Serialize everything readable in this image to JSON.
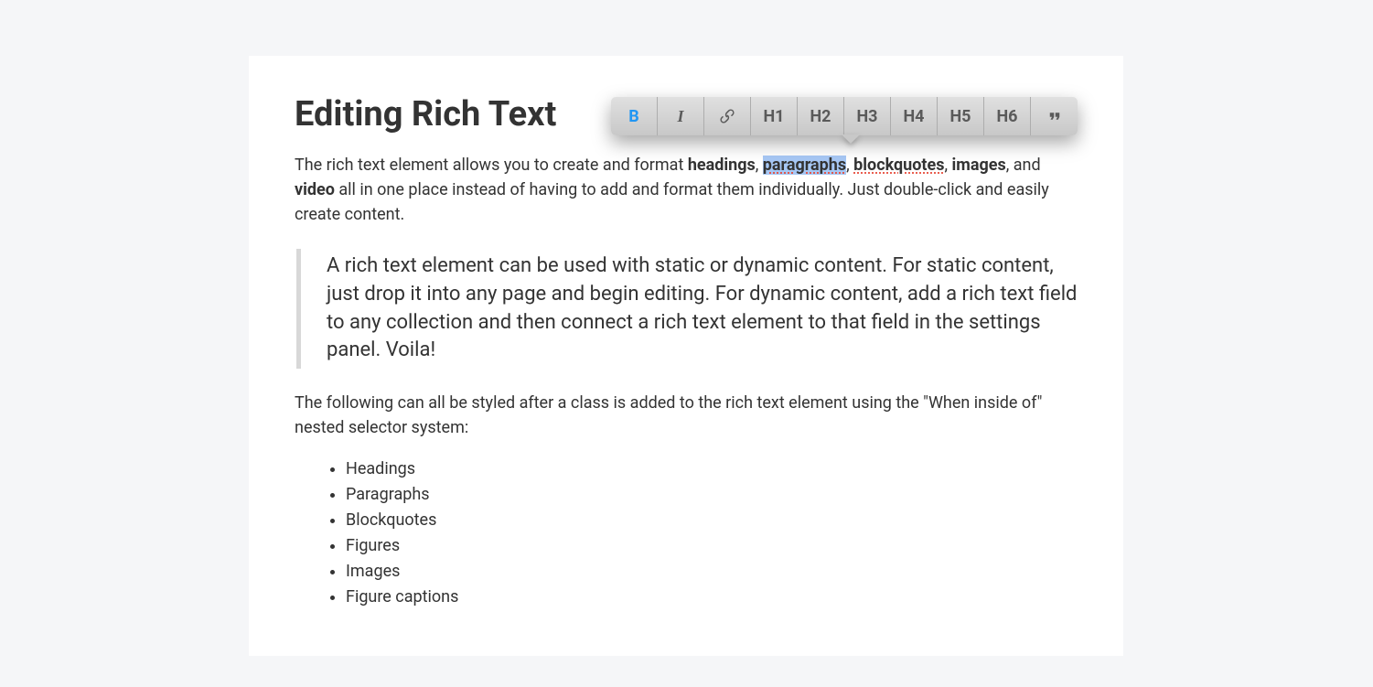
{
  "heading": "Editing Rich Text",
  "paragraph1": {
    "pre": "The rich text element allows you to create and format ",
    "headings": "headings",
    "sep1": ", ",
    "paragraphs": "paragraphs",
    "sep2": ", ",
    "blockquotes": "blockquotes",
    "sep3": ", ",
    "images": "images",
    "sep4": ", and ",
    "video": "video",
    "post": " all in one place instead of having to add and format them individually. Just double-click and easily create content."
  },
  "blockquote": "A rich text element can be used with static or dynamic content. For static content, just drop it into any page and begin editing. For dynamic content, add a rich text field to any collection and then connect a rich text element to that field in the settings panel. Voila!",
  "paragraph2": "The following can all be styled after a class is added to the rich text element using the \"When inside of\" nested selector system:",
  "list": {
    "0": "Headings",
    "1": "Paragraphs",
    "2": "Blockquotes",
    "3": "Figures",
    "4": "Images",
    "5": "Figure captions"
  },
  "toolbar": {
    "bold": "B",
    "italic": "I",
    "h1": "H1",
    "h2": "H2",
    "h3": "H3",
    "h4": "H4",
    "h5": "H5",
    "h6": "H6"
  }
}
